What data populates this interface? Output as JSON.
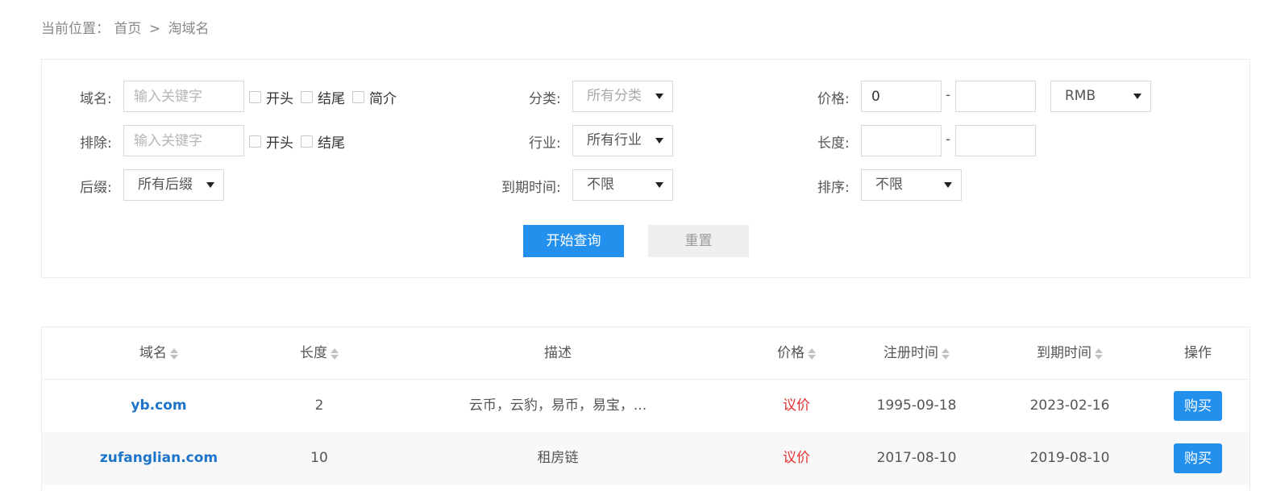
{
  "breadcrumb": {
    "prefix": "当前位置：",
    "home": "首页",
    "separator": ">",
    "current": "淘域名"
  },
  "filters": {
    "domain": {
      "label": "域名:",
      "placeholder": "输入关键字",
      "opt_start": "开头",
      "opt_end": "结尾",
      "opt_brief": "简介"
    },
    "exclude": {
      "label": "排除:",
      "placeholder": "输入关键字",
      "opt_start": "开头",
      "opt_end": "结尾"
    },
    "suffix": {
      "label": "后缀:",
      "selected": "所有后缀"
    },
    "category": {
      "label": "分类:",
      "selected": "所有分类"
    },
    "industry": {
      "label": "行业:",
      "selected": "所有行业"
    },
    "expiry": {
      "label": "到期时间:",
      "selected": "不限"
    },
    "price": {
      "label": "价格:",
      "min_value": "0",
      "max_value": "",
      "dash": "-",
      "currency": "RMB"
    },
    "length": {
      "label": "长度:",
      "min_value": "",
      "max_value": "",
      "dash": "-"
    },
    "sort": {
      "label": "排序:",
      "selected": "不限"
    },
    "search_button": "开始查询",
    "reset_button": "重置"
  },
  "table": {
    "headers": {
      "domain": "域名",
      "length": "长度",
      "desc": "描述",
      "price": "价格",
      "reg": "注册时间",
      "expire": "到期时间",
      "action": "操作"
    },
    "rows": [
      {
        "domain": "yb.com",
        "length": "2",
        "desc": "云币，云豹，易币，易宝，...",
        "price": "议价",
        "reg": "1995-09-18",
        "expire": "2023-02-16",
        "action": "购买"
      },
      {
        "domain": "zufanglian.com",
        "length": "10",
        "desc": "租房链",
        "price": "议价",
        "reg": "2017-08-10",
        "expire": "2019-08-10",
        "action": "购买"
      }
    ]
  },
  "colors": {
    "primary": "#2390ee",
    "domain_link": "#1d74c9",
    "price": "#e2312f"
  }
}
